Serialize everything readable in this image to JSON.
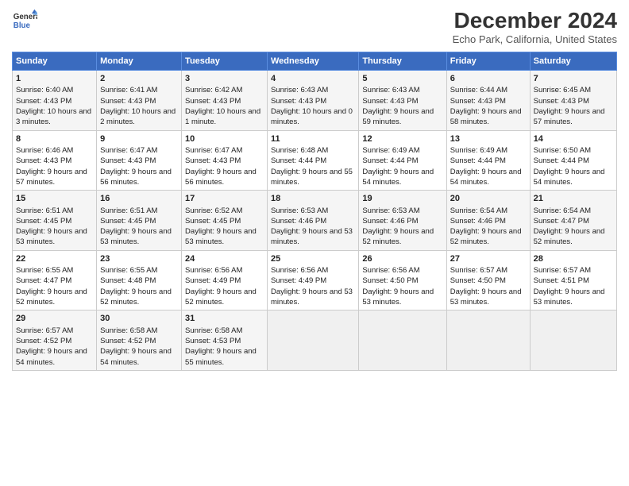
{
  "logo": {
    "line1": "General",
    "line2": "Blue"
  },
  "title": "December 2024",
  "subtitle": "Echo Park, California, United States",
  "days_of_week": [
    "Sunday",
    "Monday",
    "Tuesday",
    "Wednesday",
    "Thursday",
    "Friday",
    "Saturday"
  ],
  "weeks": [
    [
      {
        "day": "1",
        "sunrise": "Sunrise: 6:40 AM",
        "sunset": "Sunset: 4:43 PM",
        "daylight": "Daylight: 10 hours and 3 minutes."
      },
      {
        "day": "2",
        "sunrise": "Sunrise: 6:41 AM",
        "sunset": "Sunset: 4:43 PM",
        "daylight": "Daylight: 10 hours and 2 minutes."
      },
      {
        "day": "3",
        "sunrise": "Sunrise: 6:42 AM",
        "sunset": "Sunset: 4:43 PM",
        "daylight": "Daylight: 10 hours and 1 minute."
      },
      {
        "day": "4",
        "sunrise": "Sunrise: 6:43 AM",
        "sunset": "Sunset: 4:43 PM",
        "daylight": "Daylight: 10 hours and 0 minutes."
      },
      {
        "day": "5",
        "sunrise": "Sunrise: 6:43 AM",
        "sunset": "Sunset: 4:43 PM",
        "daylight": "Daylight: 9 hours and 59 minutes."
      },
      {
        "day": "6",
        "sunrise": "Sunrise: 6:44 AM",
        "sunset": "Sunset: 4:43 PM",
        "daylight": "Daylight: 9 hours and 58 minutes."
      },
      {
        "day": "7",
        "sunrise": "Sunrise: 6:45 AM",
        "sunset": "Sunset: 4:43 PM",
        "daylight": "Daylight: 9 hours and 57 minutes."
      }
    ],
    [
      {
        "day": "8",
        "sunrise": "Sunrise: 6:46 AM",
        "sunset": "Sunset: 4:43 PM",
        "daylight": "Daylight: 9 hours and 57 minutes."
      },
      {
        "day": "9",
        "sunrise": "Sunrise: 6:47 AM",
        "sunset": "Sunset: 4:43 PM",
        "daylight": "Daylight: 9 hours and 56 minutes."
      },
      {
        "day": "10",
        "sunrise": "Sunrise: 6:47 AM",
        "sunset": "Sunset: 4:43 PM",
        "daylight": "Daylight: 9 hours and 56 minutes."
      },
      {
        "day": "11",
        "sunrise": "Sunrise: 6:48 AM",
        "sunset": "Sunset: 4:44 PM",
        "daylight": "Daylight: 9 hours and 55 minutes."
      },
      {
        "day": "12",
        "sunrise": "Sunrise: 6:49 AM",
        "sunset": "Sunset: 4:44 PM",
        "daylight": "Daylight: 9 hours and 54 minutes."
      },
      {
        "day": "13",
        "sunrise": "Sunrise: 6:49 AM",
        "sunset": "Sunset: 4:44 PM",
        "daylight": "Daylight: 9 hours and 54 minutes."
      },
      {
        "day": "14",
        "sunrise": "Sunrise: 6:50 AM",
        "sunset": "Sunset: 4:44 PM",
        "daylight": "Daylight: 9 hours and 54 minutes."
      }
    ],
    [
      {
        "day": "15",
        "sunrise": "Sunrise: 6:51 AM",
        "sunset": "Sunset: 4:45 PM",
        "daylight": "Daylight: 9 hours and 53 minutes."
      },
      {
        "day": "16",
        "sunrise": "Sunrise: 6:51 AM",
        "sunset": "Sunset: 4:45 PM",
        "daylight": "Daylight: 9 hours and 53 minutes."
      },
      {
        "day": "17",
        "sunrise": "Sunrise: 6:52 AM",
        "sunset": "Sunset: 4:45 PM",
        "daylight": "Daylight: 9 hours and 53 minutes."
      },
      {
        "day": "18",
        "sunrise": "Sunrise: 6:53 AM",
        "sunset": "Sunset: 4:46 PM",
        "daylight": "Daylight: 9 hours and 53 minutes."
      },
      {
        "day": "19",
        "sunrise": "Sunrise: 6:53 AM",
        "sunset": "Sunset: 4:46 PM",
        "daylight": "Daylight: 9 hours and 52 minutes."
      },
      {
        "day": "20",
        "sunrise": "Sunrise: 6:54 AM",
        "sunset": "Sunset: 4:46 PM",
        "daylight": "Daylight: 9 hours and 52 minutes."
      },
      {
        "day": "21",
        "sunrise": "Sunrise: 6:54 AM",
        "sunset": "Sunset: 4:47 PM",
        "daylight": "Daylight: 9 hours and 52 minutes."
      }
    ],
    [
      {
        "day": "22",
        "sunrise": "Sunrise: 6:55 AM",
        "sunset": "Sunset: 4:47 PM",
        "daylight": "Daylight: 9 hours and 52 minutes."
      },
      {
        "day": "23",
        "sunrise": "Sunrise: 6:55 AM",
        "sunset": "Sunset: 4:48 PM",
        "daylight": "Daylight: 9 hours and 52 minutes."
      },
      {
        "day": "24",
        "sunrise": "Sunrise: 6:56 AM",
        "sunset": "Sunset: 4:49 PM",
        "daylight": "Daylight: 9 hours and 52 minutes."
      },
      {
        "day": "25",
        "sunrise": "Sunrise: 6:56 AM",
        "sunset": "Sunset: 4:49 PM",
        "daylight": "Daylight: 9 hours and 53 minutes."
      },
      {
        "day": "26",
        "sunrise": "Sunrise: 6:56 AM",
        "sunset": "Sunset: 4:50 PM",
        "daylight": "Daylight: 9 hours and 53 minutes."
      },
      {
        "day": "27",
        "sunrise": "Sunrise: 6:57 AM",
        "sunset": "Sunset: 4:50 PM",
        "daylight": "Daylight: 9 hours and 53 minutes."
      },
      {
        "day": "28",
        "sunrise": "Sunrise: 6:57 AM",
        "sunset": "Sunset: 4:51 PM",
        "daylight": "Daylight: 9 hours and 53 minutes."
      }
    ],
    [
      {
        "day": "29",
        "sunrise": "Sunrise: 6:57 AM",
        "sunset": "Sunset: 4:52 PM",
        "daylight": "Daylight: 9 hours and 54 minutes."
      },
      {
        "day": "30",
        "sunrise": "Sunrise: 6:58 AM",
        "sunset": "Sunset: 4:52 PM",
        "daylight": "Daylight: 9 hours and 54 minutes."
      },
      {
        "day": "31",
        "sunrise": "Sunrise: 6:58 AM",
        "sunset": "Sunset: 4:53 PM",
        "daylight": "Daylight: 9 hours and 55 minutes."
      },
      null,
      null,
      null,
      null
    ]
  ]
}
